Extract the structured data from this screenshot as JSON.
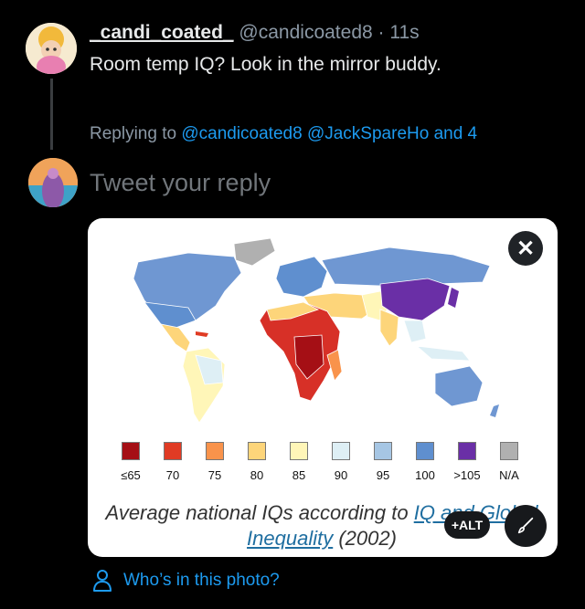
{
  "tweet": {
    "display_name": "_candi_coated_",
    "handle": "@candicoated8",
    "separator": "·",
    "time": "11s",
    "text": "Room temp IQ? Look in the mirror buddy."
  },
  "replying": {
    "prefix": "Replying to",
    "mention1": "@candicoated8",
    "mention2": "@JackSpareHo",
    "suffix": "and 4"
  },
  "composer": {
    "placeholder": "Tweet your reply"
  },
  "media": {
    "legend": [
      {
        "label": "≤65",
        "color": "#a50f15"
      },
      {
        "label": "70",
        "color": "#e03b24"
      },
      {
        "label": "75",
        "color": "#f9934b"
      },
      {
        "label": "80",
        "color": "#fdd57a"
      },
      {
        "label": "85",
        "color": "#fff6b8"
      },
      {
        "label": "90",
        "color": "#deeff5"
      },
      {
        "label": "95",
        "color": "#a6c6e4"
      },
      {
        "label": "100",
        "color": "#5f8fcf"
      },
      {
        "label": ">105",
        "color": "#6a2fa6"
      },
      {
        "label": "N/A",
        "color": "#b0b0b0"
      }
    ],
    "caption_pre": "Average national IQs according to",
    "caption_link": "IQ and Global Inequality",
    "caption_post": "(2002)",
    "close_glyph": "✕",
    "alt_label": "+ALT"
  },
  "tag_people": {
    "label": "Who’s in this photo?"
  },
  "colors": {
    "background": "#000000",
    "accent": "#1d9bf0",
    "muted": "#8b98a5"
  }
}
